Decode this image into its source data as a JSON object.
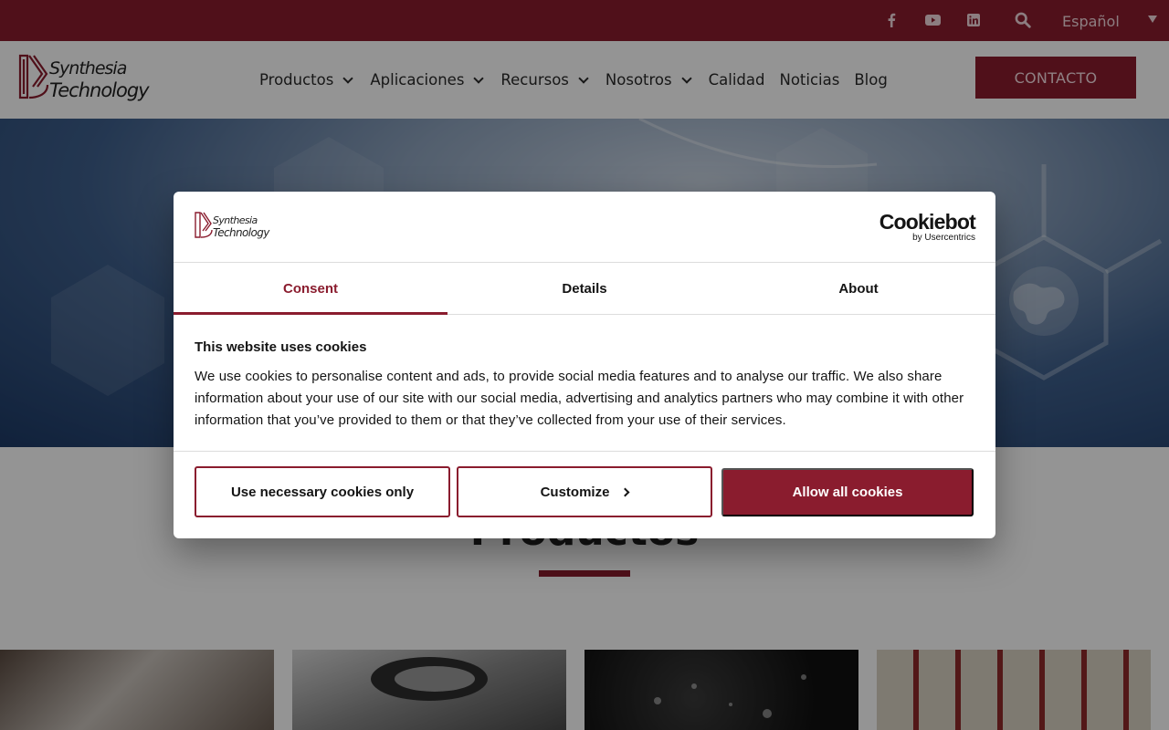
{
  "topbar": {
    "social_icons": [
      "facebook-icon",
      "youtube-icon",
      "linkedin-icon"
    ],
    "search_icon": "search-icon",
    "language": "Español"
  },
  "header": {
    "logo_line1": "Synthesia",
    "logo_line2": "Technology",
    "nav": [
      {
        "label": "Productos",
        "dropdown": true
      },
      {
        "label": "Aplicaciones",
        "dropdown": true
      },
      {
        "label": "Recursos",
        "dropdown": true
      },
      {
        "label": "Nosotros",
        "dropdown": true
      },
      {
        "label": "Calidad",
        "dropdown": false
      },
      {
        "label": "Noticias",
        "dropdown": false
      },
      {
        "label": "Blog",
        "dropdown": false
      }
    ],
    "cta_label": "CONTACTO"
  },
  "products": {
    "title": "Productos"
  },
  "dialog": {
    "logo_line1": "Synthesia",
    "logo_line2": "Technology",
    "brand_name": "Cookiebot",
    "brand_by": "by Usercentrics",
    "tabs": [
      {
        "label": "Consent",
        "active": true
      },
      {
        "label": "Details",
        "active": false
      },
      {
        "label": "About",
        "active": false
      }
    ],
    "title": "This website uses cookies",
    "text": "We use cookies to personalise content and ads, to provide social media features and to analyse our traffic. We also share information about your use of our site with our social media, advertising and analytics partners who may combine it with other information that you’ve provided to them or that they’ve collected from your use of their services.",
    "buttons": {
      "necessary": "Use necessary cookies only",
      "customize": "Customize",
      "allow_all": "Allow all cookies"
    }
  },
  "colors": {
    "brand": "#8a1c2e",
    "text": "#141414",
    "divider": "#dcdcdc"
  }
}
